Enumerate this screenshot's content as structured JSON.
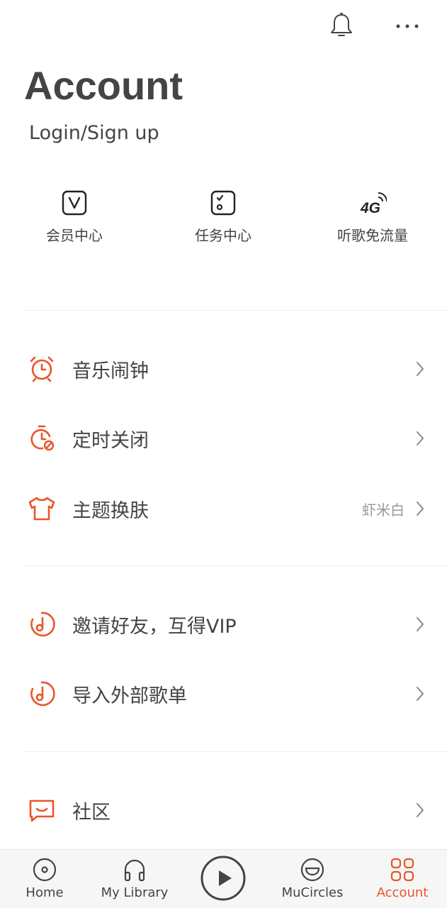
{
  "header": {
    "icons": [
      "bell-icon",
      "more-icon"
    ]
  },
  "page": {
    "title": "Account",
    "login_label": "Login/Sign up"
  },
  "quick_actions": [
    {
      "label": "会员中心",
      "icon": "vip-icon"
    },
    {
      "label": "任务中心",
      "icon": "task-icon"
    },
    {
      "label": "听歌免流量",
      "icon": "4g-icon",
      "icon_text": "4G"
    }
  ],
  "menu": {
    "alarm": {
      "label": "音乐闹钟",
      "icon": "alarm-clock-icon"
    },
    "timer": {
      "label": "定时关闭",
      "icon": "sleep-timer-icon"
    },
    "theme": {
      "label": "主题换肤",
      "value": "虾米白",
      "icon": "shirt-icon"
    },
    "invite": {
      "label": "邀请好友，互得VIP",
      "icon": "music-note-icon"
    },
    "import": {
      "label": "导入外部歌单",
      "icon": "music-note-icon"
    },
    "community": {
      "label": "社区",
      "icon": "chat-icon"
    }
  },
  "tabbar": {
    "home": "Home",
    "library": "My Library",
    "circles": "MuCircles",
    "account": "Account",
    "active": "account"
  },
  "colors": {
    "accent": "#e8552a",
    "text": "#444444",
    "muted": "#999999",
    "tabbar_bg": "#f6f6f6"
  }
}
